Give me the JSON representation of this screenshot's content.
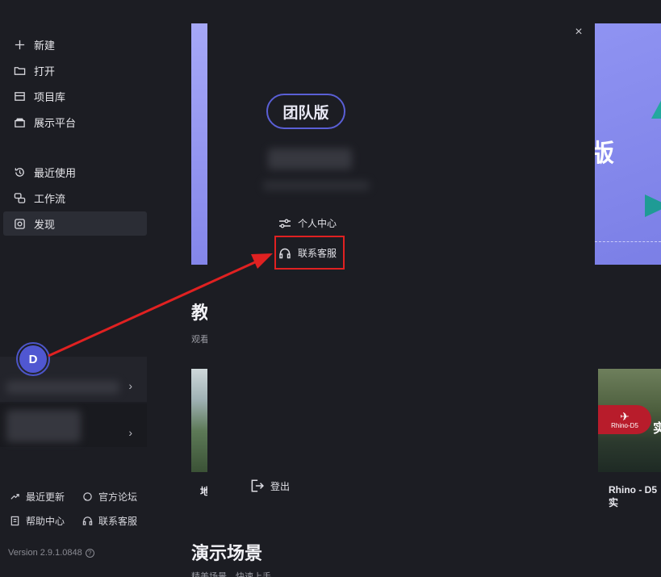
{
  "sidebar": {
    "top_items": [
      {
        "label": "新建",
        "icon": "plus-icon"
      },
      {
        "label": "打开",
        "icon": "folder-icon"
      },
      {
        "label": "项目库",
        "icon": "library-icon"
      },
      {
        "label": "展示平台",
        "icon": "showcase-icon"
      }
    ],
    "mid_items": [
      {
        "label": "最近使用",
        "icon": "history-icon"
      },
      {
        "label": "工作流",
        "icon": "workflow-icon"
      },
      {
        "label": "发现",
        "icon": "discover-icon",
        "active": true
      }
    ],
    "avatar_initial": "D",
    "footer": {
      "recent_updates": "最近更新",
      "forum": "官方论坛",
      "help_center": "帮助中心",
      "support": "联系客服"
    },
    "version": "Version 2.9.1.0848"
  },
  "main": {
    "banner_text": "版",
    "section1_title": "教",
    "section1_sub": "观看",
    "thumb_left_caption": "地",
    "thumb_right_badge_top": "✈",
    "thumb_right_badge": "Rhino-D5",
    "thumb_right_big": "实",
    "thumb_right_caption": "Rhino - D5实",
    "section2_title": "演示场景",
    "section2_sub": "精美场景，快速上手"
  },
  "popover": {
    "plan_badge": "团队版",
    "personal_center": "个人中心",
    "contact_support": "联系客服",
    "logout": "登出",
    "close_glyph": "×"
  },
  "annotation": {
    "color": "#e02121"
  }
}
